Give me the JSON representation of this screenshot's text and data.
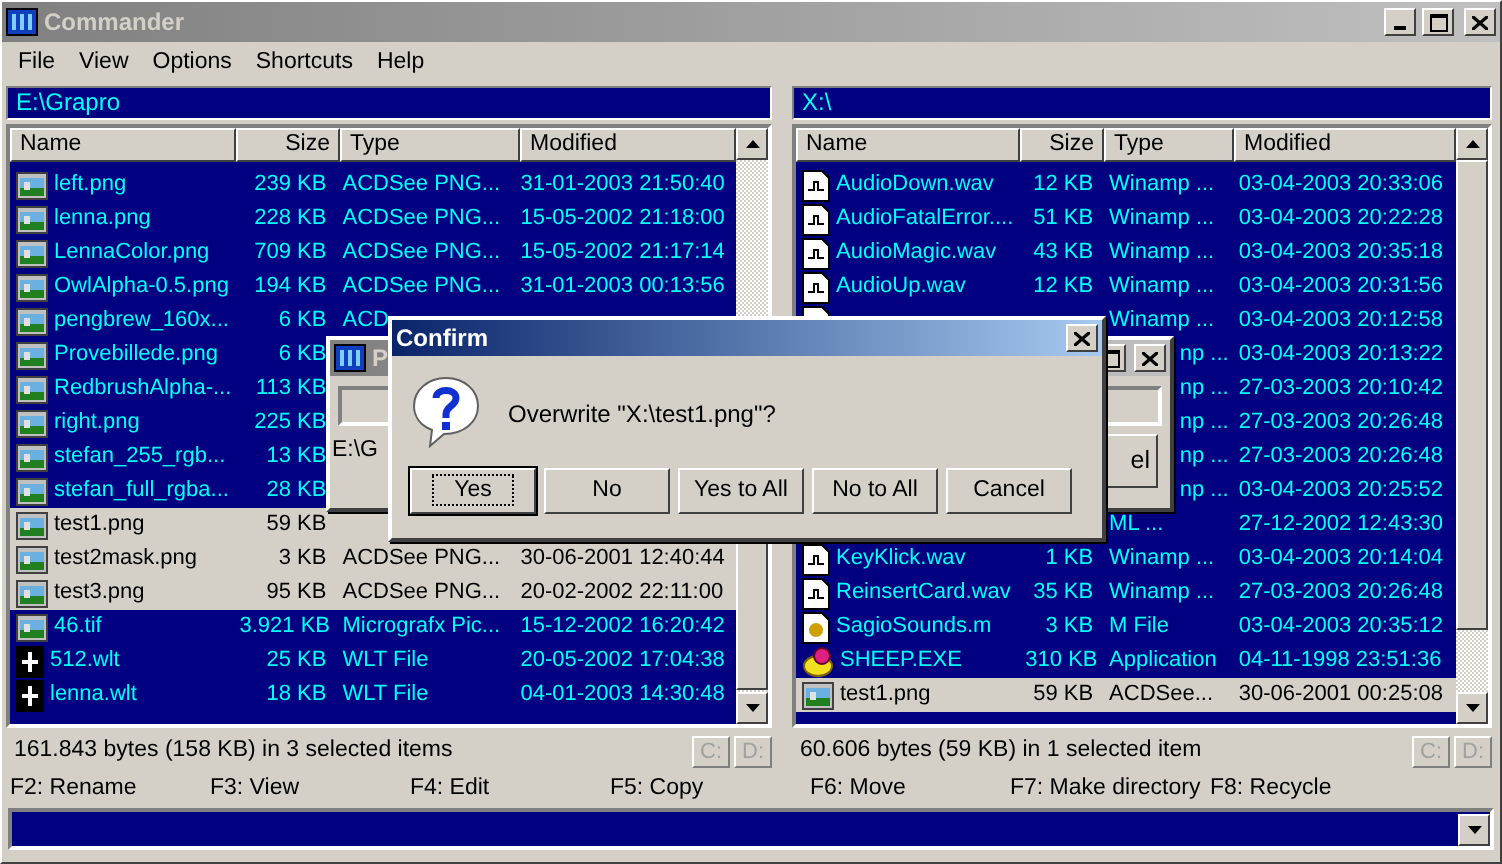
{
  "window": {
    "title": "Commander"
  },
  "menu": [
    "File",
    "View",
    "Options",
    "Shortcuts",
    "Help"
  ],
  "left_pane": {
    "path": "E:\\Grapro",
    "columns": [
      "Name",
      "Size",
      "Type",
      "Modified"
    ],
    "rows": [
      {
        "kind": "image",
        "name": "left.png",
        "size": "239 KB",
        "type": "ACDSee PNG...",
        "modified": "31-01-2003 21:50:40",
        "selected": false
      },
      {
        "kind": "image",
        "name": "lenna.png",
        "size": "228 KB",
        "type": "ACDSee PNG...",
        "modified": "15-05-2002 21:18:00",
        "selected": false
      },
      {
        "kind": "image",
        "name": "LennaColor.png",
        "size": "709 KB",
        "type": "ACDSee PNG...",
        "modified": "15-05-2002 21:17:14",
        "selected": false
      },
      {
        "kind": "image",
        "name": "OwlAlpha-0.5.png",
        "size": "194 KB",
        "type": "ACDSee PNG...",
        "modified": "31-01-2003 00:13:56",
        "selected": false
      },
      {
        "kind": "image",
        "name": "pengbrew_160x...",
        "size": "6 KB",
        "type": "ACD",
        "selected": false
      },
      {
        "kind": "image",
        "name": "Provebillede.png",
        "size": "6 KB",
        "selected": false
      },
      {
        "kind": "image",
        "name": "RedbrushAlpha-...",
        "size": "113 KB",
        "selected": false
      },
      {
        "kind": "image",
        "name": "right.png",
        "size": "225 KB",
        "selected": false
      },
      {
        "kind": "image",
        "name": "stefan_255_rgb...",
        "size": "13 KB",
        "selected": false
      },
      {
        "kind": "image",
        "name": "stefan_full_rgba...",
        "size": "28 KB",
        "selected": false
      },
      {
        "kind": "image",
        "name": "test1.png",
        "size": "59 KB",
        "selected": true
      },
      {
        "kind": "image",
        "name": "test2mask.png",
        "size": "3 KB",
        "type": "ACDSee PNG...",
        "modified": "30-06-2001 12:40:44",
        "selected": true
      },
      {
        "kind": "image",
        "name": "test3.png",
        "size": "95 KB",
        "type": "ACDSee PNG...",
        "modified": "20-02-2002 22:11:00",
        "selected": true
      },
      {
        "kind": "image",
        "name": "46.tif",
        "size": "3.921 KB",
        "type": "Micrografx Pic...",
        "modified": "15-12-2002 16:20:42",
        "selected": false
      },
      {
        "kind": "wlt",
        "name": "512.wlt",
        "size": "25 KB",
        "type": "WLT File",
        "modified": "20-05-2002 17:04:38",
        "selected": false
      },
      {
        "kind": "wlt",
        "name": "lenna.wlt",
        "size": "18 KB",
        "type": "WLT File",
        "modified": "04-01-2003 14:30:48",
        "selected": false
      }
    ],
    "status": "161.843 bytes (158 KB) in 3 selected items",
    "drives": [
      {
        "label": "C:",
        "disabled": true
      },
      {
        "label": "D:",
        "disabled": true
      }
    ]
  },
  "right_pane": {
    "path": "X:\\",
    "columns": [
      "Name",
      "Size",
      "Type",
      "Modified"
    ],
    "rows": [
      {
        "kind": "audio",
        "name": "AudioDown.wav",
        "size": "12 KB",
        "type": "Winamp ...",
        "modified": "03-04-2003 20:33:06",
        "selected": false
      },
      {
        "kind": "audio",
        "name": "AudioFatalError....",
        "size": "51 KB",
        "type": "Winamp ...",
        "modified": "03-04-2003 20:22:28",
        "selected": false
      },
      {
        "kind": "audio",
        "name": "AudioMagic.wav",
        "size": "43 KB",
        "type": "Winamp ...",
        "modified": "03-04-2003 20:35:18",
        "selected": false
      },
      {
        "kind": "audio",
        "name": "AudioUp.wav",
        "size": "12 KB",
        "type": "Winamp ...",
        "modified": "03-04-2003 20:31:56",
        "selected": false
      },
      {
        "kind": "audio",
        "type": "Winamp ...",
        "modified": "03-04-2003 20:12:58",
        "selected": false
      },
      {
        "type": "np ...",
        "type_cut": true,
        "modified": "03-04-2003 20:13:22",
        "selected": false
      },
      {
        "type": "np ...",
        "type_cut": true,
        "modified": "27-03-2003 20:10:42",
        "selected": false
      },
      {
        "type": "np ...",
        "type_cut": true,
        "modified": "27-03-2003 20:26:48",
        "selected": false
      },
      {
        "type": "np ...",
        "type_cut": true,
        "modified": "27-03-2003 20:26:48",
        "selected": false
      },
      {
        "type": "np ...",
        "type_cut": true,
        "modified": "03-04-2003 20:25:52",
        "selected": false
      },
      {
        "type": "ML ...",
        "modified": "27-12-2002 12:43:30",
        "selected": false
      },
      {
        "kind": "audio",
        "name": "KeyKlick.wav",
        "size": "1 KB",
        "type": "Winamp ...",
        "modified": "03-04-2003 20:14:04",
        "selected": false
      },
      {
        "kind": "audio",
        "name": "ReinsertCard.wav",
        "size": "35 KB",
        "type": "Winamp ...",
        "modified": "27-03-2003 20:26:48",
        "selected": false
      },
      {
        "kind": "script",
        "name": "SagioSounds.m",
        "size": "3 KB",
        "type": "M File",
        "modified": "03-04-2003 20:35:12",
        "selected": false
      },
      {
        "kind": "app",
        "name": "SHEEP.EXE",
        "size": "310 KB",
        "type": "Application",
        "modified": "04-11-1998 23:51:36",
        "selected": false
      },
      {
        "kind": "image",
        "name": "test1.png",
        "size": "59 KB",
        "type": "ACDSee...",
        "modified": "30-06-2001 00:25:08",
        "selected": true
      }
    ],
    "status": "60.606 bytes (59 KB) in 1 selected item",
    "drives": [
      {
        "label": "C:",
        "disabled": true
      },
      {
        "label": "D:",
        "disabled": true
      }
    ]
  },
  "function_keys": [
    "F2: Rename",
    "F3: View",
    "F4: Edit",
    "F5: Copy",
    "F6: Move",
    "F7: Make directory",
    "F8: Recycle"
  ],
  "progress_window": {
    "title": "P",
    "path": "E:\\G",
    "button": "el"
  },
  "confirm_dialog": {
    "title": "Confirm",
    "message": "Overwrite \"X:\\test1.png\"?",
    "buttons": [
      {
        "label": "Yes",
        "focused": true
      },
      {
        "label": "No",
        "focused": false
      },
      {
        "label": "Yes to All",
        "focused": false
      },
      {
        "label": "No to All",
        "focused": false
      },
      {
        "label": "Cancel",
        "focused": false
      }
    ]
  }
}
